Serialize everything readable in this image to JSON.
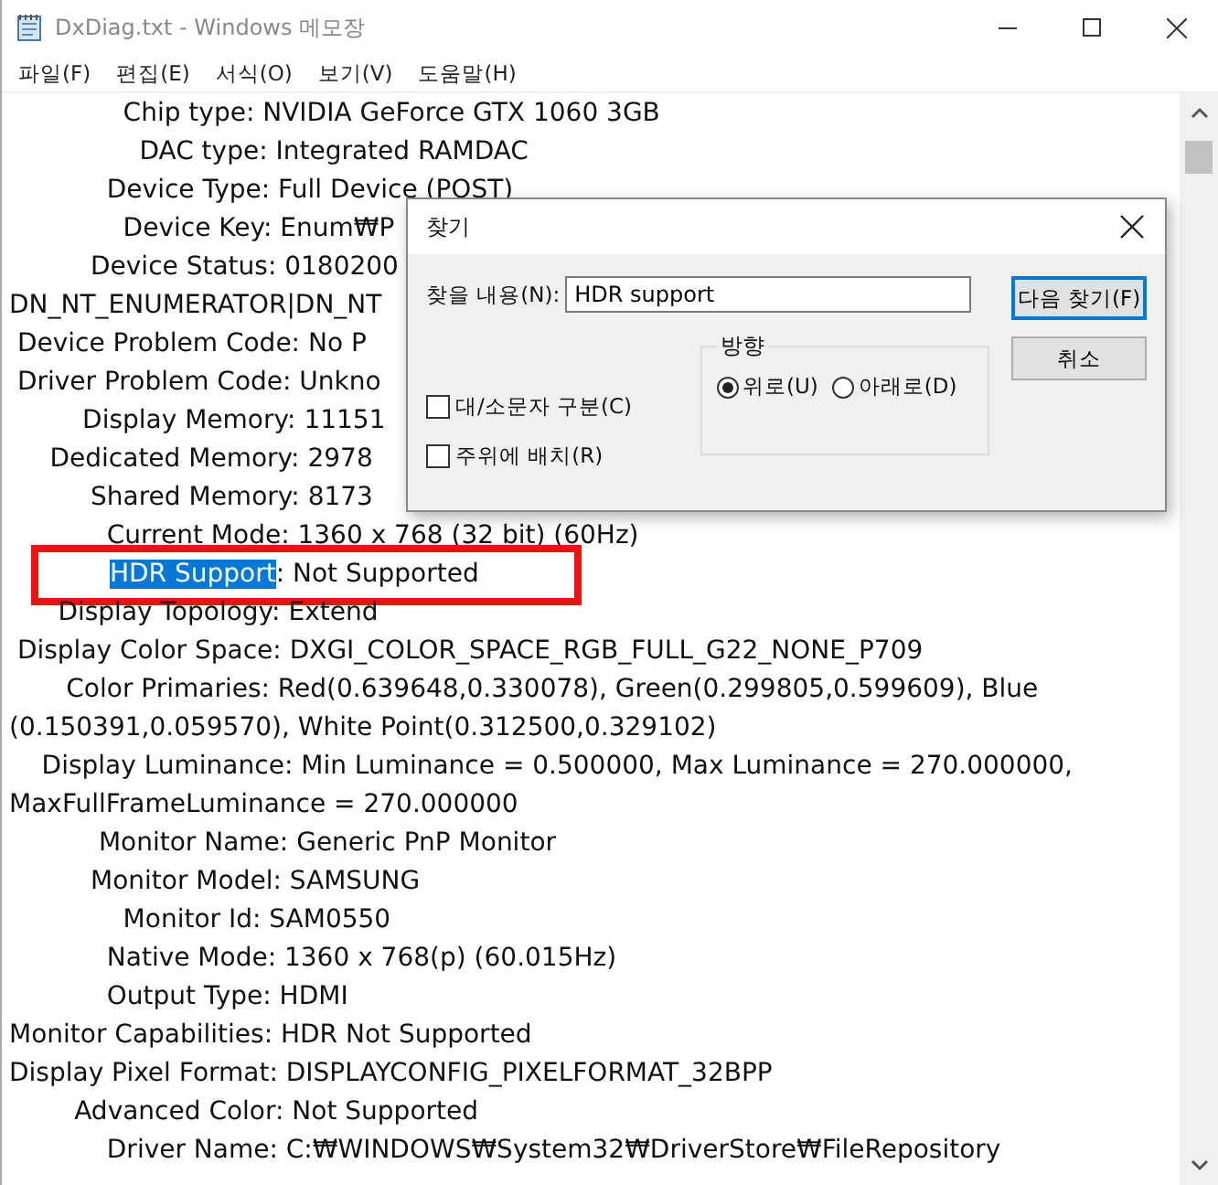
{
  "window": {
    "title": "DxDiag.txt - Windows 메모장"
  },
  "menu": [
    {
      "label": "파일(F)"
    },
    {
      "label": "편집(E)"
    },
    {
      "label": "서식(O)"
    },
    {
      "label": "보기(V)"
    },
    {
      "label": "도움말(H)"
    }
  ],
  "lines": [
    {
      "text": "              Chip type: NVIDIA GeForce GTX 1060 3GB"
    },
    {
      "text": "                DAC type: Integrated RAMDAC"
    },
    {
      "text": "            Device Type: Full Device (POST)"
    },
    {
      "text": "              Device Key: Enum₩P"
    },
    {
      "text": "          Device Status: 0180200"
    },
    {
      "text": "DN_NT_ENUMERATOR|DN_NT"
    },
    {
      "text": " Device Problem Code: No P"
    },
    {
      "text": " Driver Problem Code: Unkno"
    },
    {
      "text": "         Display Memory: 11151"
    },
    {
      "text": "     Dedicated Memory: 2978"
    },
    {
      "text": "          Shared Memory: 8173"
    },
    {
      "text": "            Current Mode: 1360 x 768 (32 bit) (60Hz)"
    },
    {
      "kind": "found",
      "selected_text": "HDR Support",
      "text": ": Not Supported"
    },
    {
      "text": "      Display Topology: Extend"
    },
    {
      "text": " Display Color Space: DXGI_COLOR_SPACE_RGB_FULL_G22_NONE_P709"
    },
    {
      "text": "       Color Primaries: Red(0.639648,0.330078), Green(0.299805,0.599609), Blue"
    },
    {
      "text": "(0.150391,0.059570), White Point(0.312500,0.329102)"
    },
    {
      "text": "    Display Luminance: Min Luminance = 0.500000, Max Luminance = 270.000000,"
    },
    {
      "text": "MaxFullFrameLuminance = 270.000000"
    },
    {
      "text": "           Monitor Name: Generic PnP Monitor"
    },
    {
      "text": "          Monitor Model: SAMSUNG"
    },
    {
      "text": "              Monitor Id: SAM0550"
    },
    {
      "text": "            Native Mode: 1360 x 768(p) (60.015Hz)"
    },
    {
      "text": "            Output Type: HDMI"
    },
    {
      "text": "Monitor Capabilities: HDR Not Supported"
    },
    {
      "text": "Display Pixel Format: DISPLAYCONFIG_PIXELFORMAT_32BPP"
    },
    {
      "text": "        Advanced Color: Not Supported"
    },
    {
      "text": "            Driver Name: C:₩WINDOWS₩System32₩DriverStore₩FileRepository"
    }
  ],
  "find_dialog": {
    "title": "찾기",
    "find_label": "찾을 내용(N):",
    "find_value": "HDR support",
    "buttons": [
      {
        "label": "다음 찾기(F)",
        "default": true
      },
      {
        "label": "취소",
        "default": false
      }
    ],
    "direction": {
      "label": "방향",
      "options": [
        {
          "label": "위로(U)",
          "selected": true
        },
        {
          "label": "아래로(D)",
          "selected": false
        }
      ]
    },
    "checkboxes": [
      {
        "label": "대/소문자 구분(C)",
        "checked": false
      },
      {
        "label": "주위에 배치(R)",
        "checked": false
      }
    ]
  }
}
